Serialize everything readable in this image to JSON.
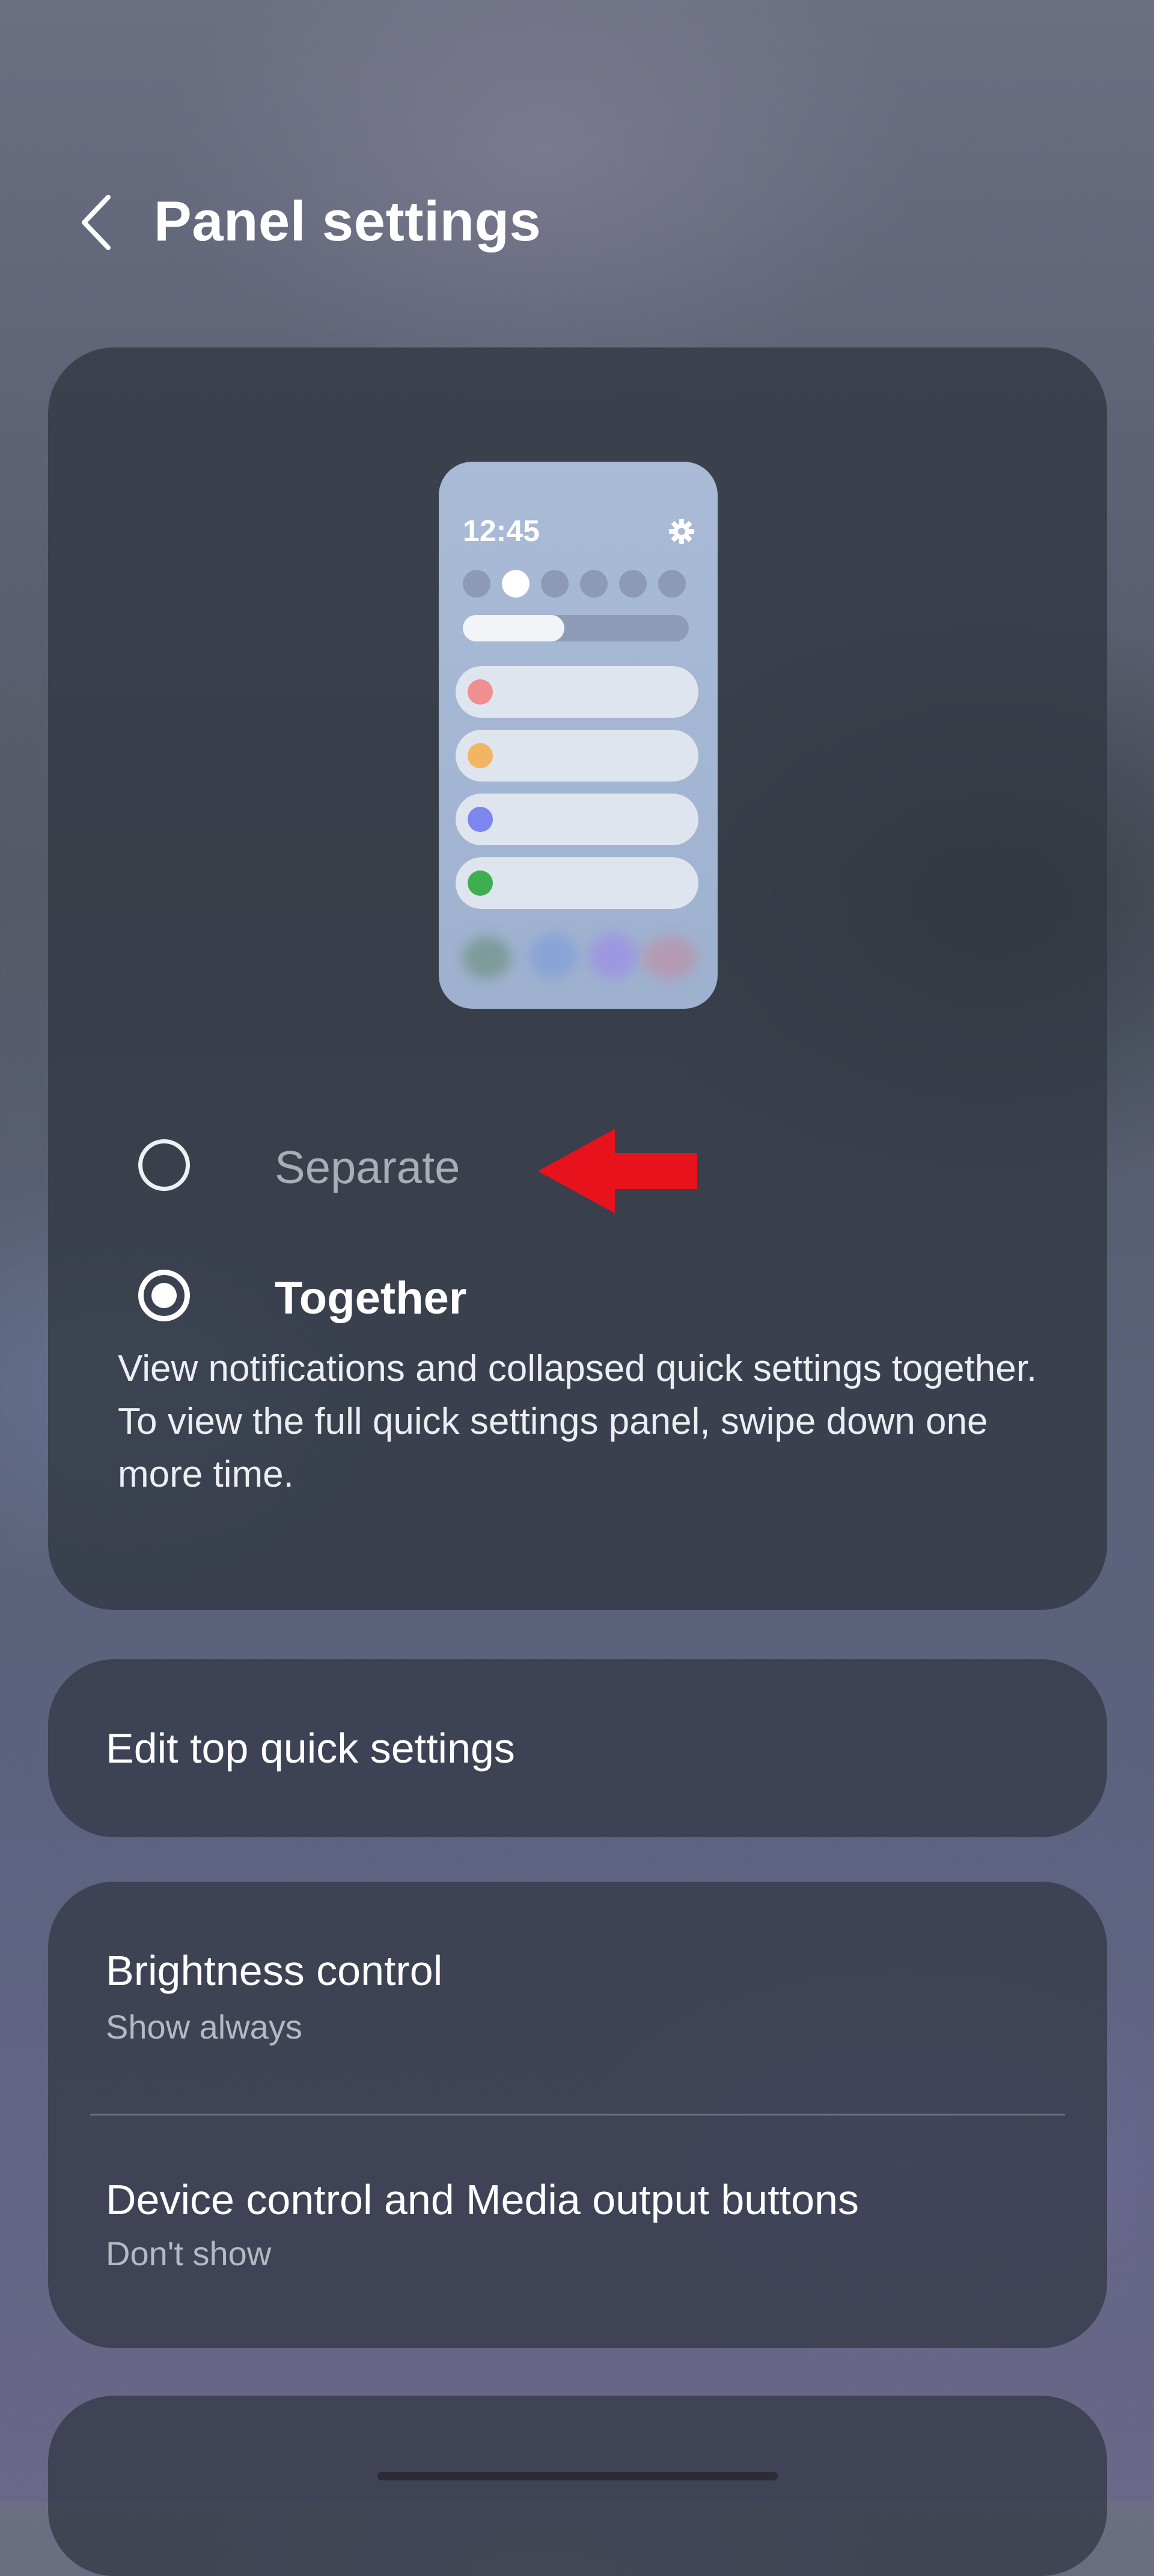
{
  "header": {
    "title": "Panel settings",
    "back_icon": "chevron-left-icon"
  },
  "preview": {
    "time": "12:45",
    "settings_icon": "gear-icon",
    "brightness_level": 0.45,
    "quick_settings_count": 6,
    "notification_colors": [
      "#ef8f8f",
      "#f3b463",
      "#7d86ee",
      "#3fae50"
    ]
  },
  "options": {
    "separate_label": "Separate",
    "together_label": "Together",
    "selected": "together",
    "description": "View notifications and collapsed quick settings together. To view the full quick settings panel, swipe down one more time."
  },
  "annotation": {
    "arrow_color": "#e8121c",
    "arrow_icon": "arrow-left-icon"
  },
  "edit": {
    "label": "Edit top quick settings"
  },
  "brightness": {
    "label": "Brightness control",
    "value": "Show always"
  },
  "device_control": {
    "label": "Device control and Media output buttons",
    "value": "Don't show"
  },
  "colors": {
    "text_primary": "#ffffff",
    "text_secondary": "#b4b9c3",
    "card_bg": "#343a48",
    "preview_bg": "#a9bbd6"
  }
}
